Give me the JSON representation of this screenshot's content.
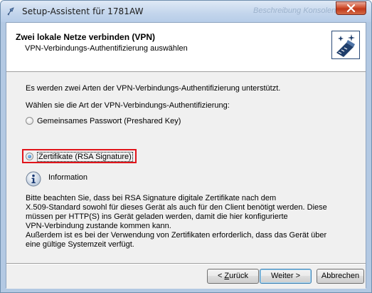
{
  "window": {
    "title": "Setup-Assistent für 1781AW",
    "ghost_title": "Beschreibung  Konsolen",
    "close_icon": "close-x-icon"
  },
  "header": {
    "title": "Zwei lokale Netze verbinden (VPN)",
    "subtitle": "VPN-Verbindungs-Authentifizierung auswählen",
    "icon": "network-wizard-icon"
  },
  "body": {
    "intro": "Es werden zwei Arten der VPN-Verbindungs-Authentifizierung unterstützt.",
    "prompt": "Wählen sie die Art der VPN-Verbindungs-Authentifizierung:",
    "options": [
      {
        "label": "Gemeinsames Passwort (Preshared Key)",
        "checked": false
      },
      {
        "label": "Zertifikate (RSA Signature)",
        "checked": true
      }
    ],
    "info_label": "Information",
    "info_lines": [
      "Bitte beachten Sie, dass bei RSA Signature digitale Zertifikate nach dem",
      "X.509-Standard sowohl für dieses Gerät als auch für den Client benötigt werden. Diese",
      "müssen per HTTP(S) ins Gerät geladen werden, damit die hier konfigurierte",
      "VPN-Verbindung zustande kommen kann.",
      "Außerdem ist es bei der Verwendung von Zertifikaten erforderlich, dass das Gerät über",
      "eine gültige Systemzeit verfügt."
    ],
    "highlight_color": "#e1151b"
  },
  "footer": {
    "back_accel": "Z",
    "back_rest": "urück",
    "back_prefix": "< ",
    "next": "Weiter >",
    "cancel": "Abbrechen"
  }
}
